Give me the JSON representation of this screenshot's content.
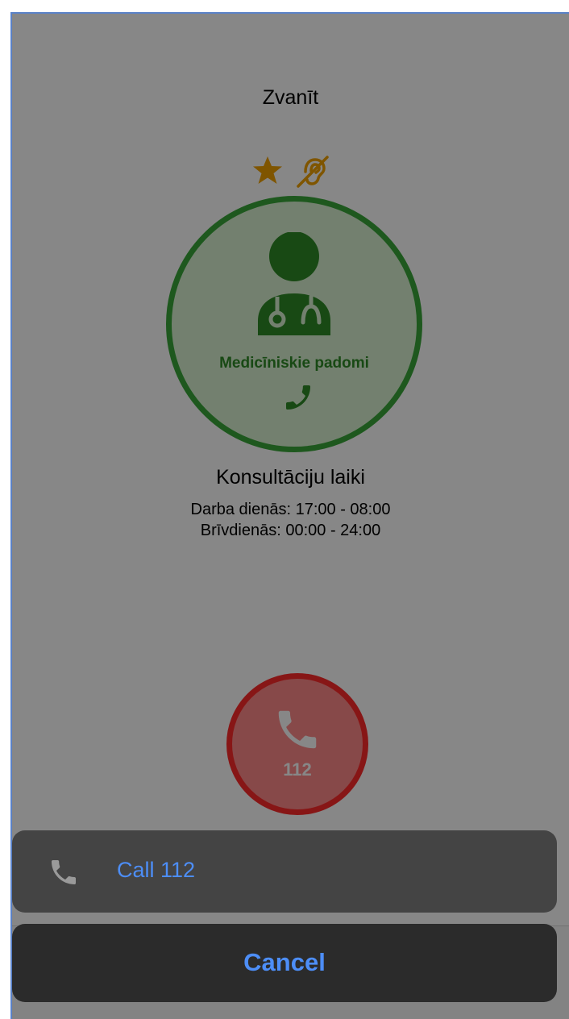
{
  "header": {
    "title": "Zvanīt"
  },
  "badges": [
    {
      "icon": "star-icon",
      "color": "#f0a000"
    },
    {
      "icon": "hearing-impaired-icon",
      "color": "#f0a000"
    }
  ],
  "service": {
    "label": "Medicīniskie padomi",
    "icon": "doctor-icon",
    "call_icon": "phone-icon",
    "accent": "#2f8a26"
  },
  "hours": {
    "title": "Konsultāciju laiki",
    "weekdays": "Darba dienās: 17:00 - 08:00",
    "weekends": "Brīvdienās: 00:00 - 24:00"
  },
  "emergency": {
    "number": "112",
    "accent": "#ff2a2a"
  },
  "action_sheet": {
    "action_label": "Call 112",
    "cancel_label": "Cancel",
    "accent": "#4d8ef7"
  }
}
